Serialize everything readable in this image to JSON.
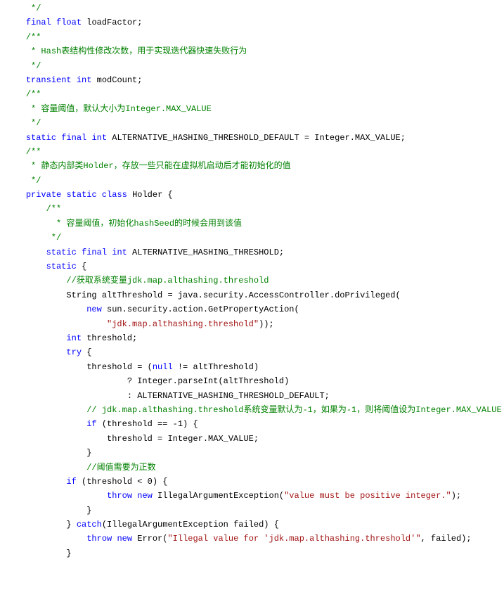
{
  "lines": [
    {
      "indent": 1,
      "segs": [
        {
          "t": " */",
          "c": "cm"
        }
      ]
    },
    {
      "indent": 1,
      "segs": [
        {
          "t": "final",
          "c": "kw"
        },
        {
          "t": " "
        },
        {
          "t": "float",
          "c": "kw"
        },
        {
          "t": " loadFactor;"
        }
      ]
    },
    {
      "indent": 0,
      "segs": [
        {
          "t": ""
        }
      ]
    },
    {
      "indent": 1,
      "segs": [
        {
          "t": "/**",
          "c": "cm"
        }
      ]
    },
    {
      "indent": 1,
      "segs": [
        {
          "t": " * Hash表结构性修改次数，用于实现迭代器快速失败行为",
          "c": "cm"
        }
      ]
    },
    {
      "indent": 1,
      "segs": [
        {
          "t": " */",
          "c": "cm"
        }
      ]
    },
    {
      "indent": 1,
      "segs": [
        {
          "t": "transient",
          "c": "kw"
        },
        {
          "t": " "
        },
        {
          "t": "int",
          "c": "kw"
        },
        {
          "t": " modCount;"
        }
      ]
    },
    {
      "indent": 0,
      "segs": [
        {
          "t": ""
        }
      ]
    },
    {
      "indent": 1,
      "segs": [
        {
          "t": "/**",
          "c": "cm"
        }
      ]
    },
    {
      "indent": 1,
      "segs": [
        {
          "t": " * 容量阈值，默认大小为Integer.MAX_VALUE",
          "c": "cm"
        }
      ]
    },
    {
      "indent": 1,
      "segs": [
        {
          "t": " */",
          "c": "cm"
        }
      ]
    },
    {
      "indent": 1,
      "segs": [
        {
          "t": "static",
          "c": "kw"
        },
        {
          "t": " "
        },
        {
          "t": "final",
          "c": "kw"
        },
        {
          "t": " "
        },
        {
          "t": "int",
          "c": "kw"
        },
        {
          "t": " ALTERNATIVE_HASHING_THRESHOLD_DEFAULT = Integer.MAX_VALUE;"
        }
      ]
    },
    {
      "indent": 0,
      "segs": [
        {
          "t": ""
        }
      ]
    },
    {
      "indent": 1,
      "segs": [
        {
          "t": "/**",
          "c": "cm"
        }
      ]
    },
    {
      "indent": 1,
      "segs": [
        {
          "t": " * 静态内部类Holder，存放一些只能在虚拟机启动后才能初始化的值",
          "c": "cm"
        }
      ]
    },
    {
      "indent": 1,
      "segs": [
        {
          "t": " */",
          "c": "cm"
        }
      ]
    },
    {
      "indent": 1,
      "segs": [
        {
          "t": "private",
          "c": "kw"
        },
        {
          "t": " "
        },
        {
          "t": "static",
          "c": "kw"
        },
        {
          "t": " "
        },
        {
          "t": "class",
          "c": "kw"
        },
        {
          "t": " Holder {"
        }
      ]
    },
    {
      "indent": 0,
      "segs": [
        {
          "t": ""
        }
      ]
    },
    {
      "indent": 2,
      "segs": [
        {
          "t": "/**",
          "c": "cm"
        }
      ]
    },
    {
      "indent": 2,
      "segs": [
        {
          "t": "  * 容量阈值，初始化hashSeed的时候会用到该值",
          "c": "cm"
        }
      ]
    },
    {
      "indent": 2,
      "segs": [
        {
          "t": " */",
          "c": "cm"
        }
      ]
    },
    {
      "indent": 2,
      "segs": [
        {
          "t": "static",
          "c": "kw"
        },
        {
          "t": " "
        },
        {
          "t": "final",
          "c": "kw"
        },
        {
          "t": " "
        },
        {
          "t": "int",
          "c": "kw"
        },
        {
          "t": " ALTERNATIVE_HASHING_THRESHOLD;"
        }
      ]
    },
    {
      "indent": 0,
      "segs": [
        {
          "t": ""
        }
      ]
    },
    {
      "indent": 2,
      "segs": [
        {
          "t": "static",
          "c": "kw"
        },
        {
          "t": " {"
        }
      ]
    },
    {
      "indent": 3,
      "segs": [
        {
          "t": "//获取系统变量jdk.map.althashing.threshold",
          "c": "cm"
        }
      ]
    },
    {
      "indent": 3,
      "segs": [
        {
          "t": "String altThreshold = java.security.AccessController.doPrivileged("
        }
      ]
    },
    {
      "indent": 4,
      "segs": [
        {
          "t": "new",
          "c": "kw"
        },
        {
          "t": " sun.security.action.GetPropertyAction("
        }
      ]
    },
    {
      "indent": 5,
      "segs": [
        {
          "t": "\"jdk.map.althashing.threshold\"",
          "c": "str"
        },
        {
          "t": "));"
        }
      ]
    },
    {
      "indent": 0,
      "segs": [
        {
          "t": ""
        }
      ]
    },
    {
      "indent": 3,
      "segs": [
        {
          "t": "int",
          "c": "kw"
        },
        {
          "t": " threshold;"
        }
      ]
    },
    {
      "indent": 3,
      "segs": [
        {
          "t": "try",
          "c": "kw"
        },
        {
          "t": " {"
        }
      ]
    },
    {
      "indent": 4,
      "segs": [
        {
          "t": "threshold = ("
        },
        {
          "t": "null",
          "c": "kw"
        },
        {
          "t": " != altThreshold)"
        }
      ]
    },
    {
      "indent": 6,
      "segs": [
        {
          "t": "? Integer.parseInt(altThreshold)"
        }
      ]
    },
    {
      "indent": 6,
      "segs": [
        {
          "t": ": ALTERNATIVE_HASHING_THRESHOLD_DEFAULT;"
        }
      ]
    },
    {
      "indent": 0,
      "segs": [
        {
          "t": ""
        }
      ]
    },
    {
      "indent": 4,
      "segs": [
        {
          "t": "// jdk.map.althashing.threshold系统变量默认为-1，如果为-1，则将阈值设为Integer.MAX_VALUE",
          "c": "cm"
        }
      ]
    },
    {
      "indent": 4,
      "segs": [
        {
          "t": "if",
          "c": "kw"
        },
        {
          "t": " (threshold == -1) {"
        }
      ]
    },
    {
      "indent": 5,
      "segs": [
        {
          "t": "threshold = Integer.MAX_VALUE;"
        }
      ]
    },
    {
      "indent": 4,
      "segs": [
        {
          "t": "}"
        }
      ]
    },
    {
      "indent": 4,
      "segs": [
        {
          "t": "//阈值需要为正数",
          "c": "cm"
        }
      ]
    },
    {
      "indent": 3,
      "segs": [
        {
          "t": "if",
          "c": "kw"
        },
        {
          "t": " (threshold < 0) {"
        }
      ]
    },
    {
      "indent": 5,
      "segs": [
        {
          "t": "throw",
          "c": "kw"
        },
        {
          "t": " "
        },
        {
          "t": "new",
          "c": "kw"
        },
        {
          "t": " IllegalArgumentException("
        },
        {
          "t": "\"value must be positive integer.\"",
          "c": "str"
        },
        {
          "t": ");"
        }
      ]
    },
    {
      "indent": 4,
      "segs": [
        {
          "t": "}"
        }
      ]
    },
    {
      "indent": 3,
      "segs": [
        {
          "t": "} "
        },
        {
          "t": "catch",
          "c": "kw"
        },
        {
          "t": "(IllegalArgumentException failed) {"
        }
      ]
    },
    {
      "indent": 4,
      "segs": [
        {
          "t": "throw",
          "c": "kw"
        },
        {
          "t": " "
        },
        {
          "t": "new",
          "c": "kw"
        },
        {
          "t": " Error("
        },
        {
          "t": "\"Illegal value for 'jdk.map.althashing.threshold'\"",
          "c": "str"
        },
        {
          "t": ", failed);"
        }
      ]
    },
    {
      "indent": 3,
      "segs": [
        {
          "t": "}"
        }
      ]
    }
  ]
}
